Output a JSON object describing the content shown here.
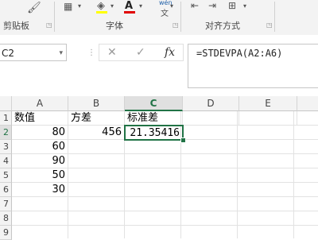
{
  "ribbon": {
    "groups": [
      {
        "label": "剪贴板"
      },
      {
        "label": "字体"
      },
      {
        "label": "对齐方式"
      }
    ],
    "wen_label": "wén",
    "wen_char": "文"
  },
  "namebox": {
    "value": "C2"
  },
  "formula_bar": {
    "cancel": "✕",
    "enter": "✓",
    "fx": "fx",
    "formula": "=STDEVPA(A2:A6)"
  },
  "columns": [
    "A",
    "B",
    "C",
    "D",
    "E"
  ],
  "rows": [
    "1",
    "2",
    "3",
    "4",
    "5",
    "6",
    "7",
    "8",
    "9"
  ],
  "cells": {
    "A1": "数值",
    "B1": "方差",
    "C1": "标准差",
    "A2": "80",
    "B2": "456",
    "C2": "21.35416",
    "A3": "60",
    "A4": "90",
    "A5": "50",
    "A6": "30"
  },
  "colors": {
    "accent": "#217346",
    "font_red": "#e00000",
    "highlight_yellow": "#ffff00"
  }
}
